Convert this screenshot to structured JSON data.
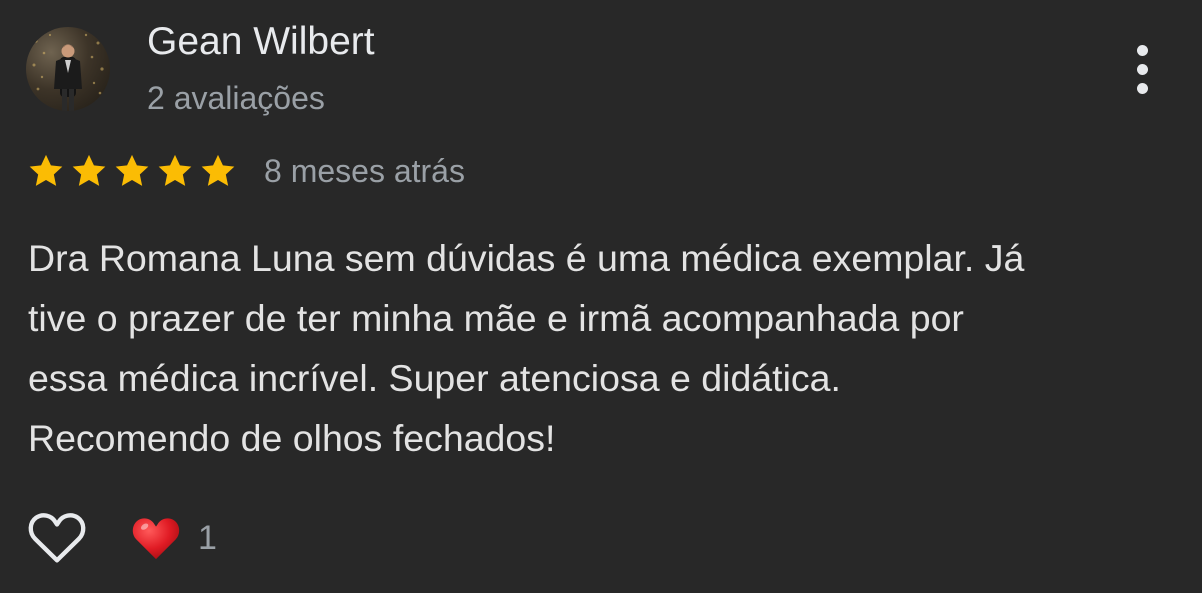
{
  "review": {
    "author_name": "Gean Wilbert",
    "author_review_count": "2 avaliações",
    "avatar_icon": "profile-photo",
    "rating": 5,
    "rating_max": 5,
    "date": "8 meses atrás",
    "text_lines": [
      "Dra Romana Luna sem dúvidas é uma médica exemplar. Já",
      "tive o prazer de ter minha mãe e irmã acompanhada por",
      "essa médica incrível. Super atenciosa e didática.",
      "Recomendo de olhos fechados!"
    ],
    "more_icon": "more-vert-icon",
    "like_icon": "heart-outline-icon",
    "reaction_icon": "red-heart-icon",
    "reaction_count": "1"
  },
  "colors": {
    "background": "#282828",
    "primary_text": "#e8eaed",
    "secondary_text": "#9aa0a6",
    "star": "#fbbc04",
    "heart": "#e01b24"
  }
}
